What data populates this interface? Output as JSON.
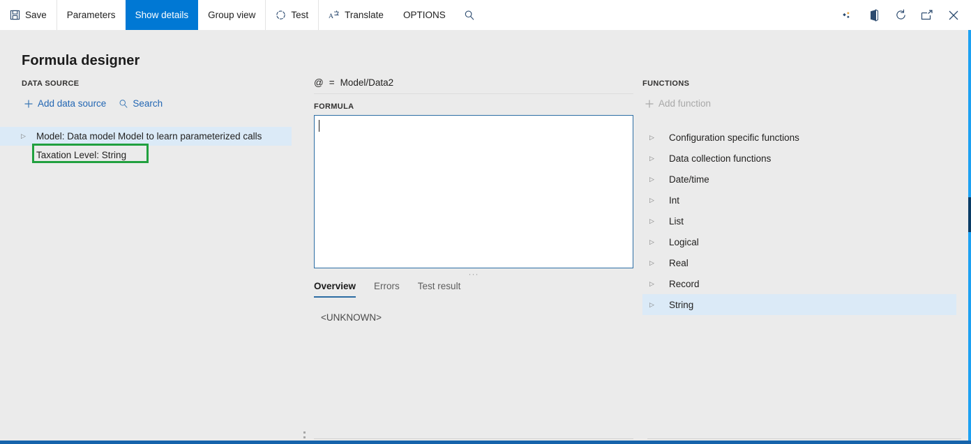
{
  "app": {
    "page_title": "Formula designer",
    "accent_color": "#0078d4",
    "highlight_color": "#21a03f",
    "selection_color": "#dbeaf7",
    "link_color": "#2266b3"
  },
  "command_bar": {
    "buttons": [
      {
        "label": "Save",
        "icon": "save-icon",
        "active": false
      },
      {
        "label": "Parameters",
        "icon": "",
        "active": false
      },
      {
        "label": "Show details",
        "icon": "",
        "active": true
      },
      {
        "label": "Group view",
        "icon": "",
        "active": false
      },
      {
        "label": "Test",
        "icon": "progress-circle-icon",
        "active": false
      },
      {
        "label": "Translate",
        "icon": "translate-icon",
        "active": false
      },
      {
        "label": "OPTIONS",
        "icon": "",
        "active": false
      }
    ],
    "search_icon": "search-icon",
    "right_icons": [
      "settings-diamond-icon",
      "office-app-icon",
      "refresh-icon",
      "popout-icon",
      "close-icon"
    ]
  },
  "data_source": {
    "label": "DATA SOURCE",
    "add_label": "Add data source",
    "add_icon": "plus-icon",
    "search_label": "Search",
    "search_icon": "search-icon",
    "tree": [
      {
        "label": "Model: Data model Model to learn parameterized calls",
        "selected": true,
        "child": false,
        "expandable": true
      },
      {
        "label": "Taxation Level: String",
        "selected": false,
        "child": true,
        "expandable": false,
        "highlighted": true
      }
    ]
  },
  "formula": {
    "binding_at": "@",
    "binding_equals": "=",
    "binding_path": "Model/Data2",
    "label": "FORMULA",
    "value": "",
    "resize_grip": "···",
    "tabs": [
      {
        "label": "Overview",
        "active": true
      },
      {
        "label": "Errors",
        "active": false
      },
      {
        "label": "Test result",
        "active": false
      }
    ],
    "overview_text": "<UNKNOWN>"
  },
  "functions": {
    "label": "FUNCTIONS",
    "add_label": "Add function",
    "add_icon": "plus-icon",
    "items": [
      {
        "label": "Configuration specific functions",
        "selected": false
      },
      {
        "label": "Data collection functions",
        "selected": false
      },
      {
        "label": "Date/time",
        "selected": false
      },
      {
        "label": "Int",
        "selected": false
      },
      {
        "label": "List",
        "selected": false
      },
      {
        "label": "Logical",
        "selected": false
      },
      {
        "label": "Real",
        "selected": false
      },
      {
        "label": "Record",
        "selected": false
      },
      {
        "label": "String",
        "selected": true
      }
    ]
  }
}
